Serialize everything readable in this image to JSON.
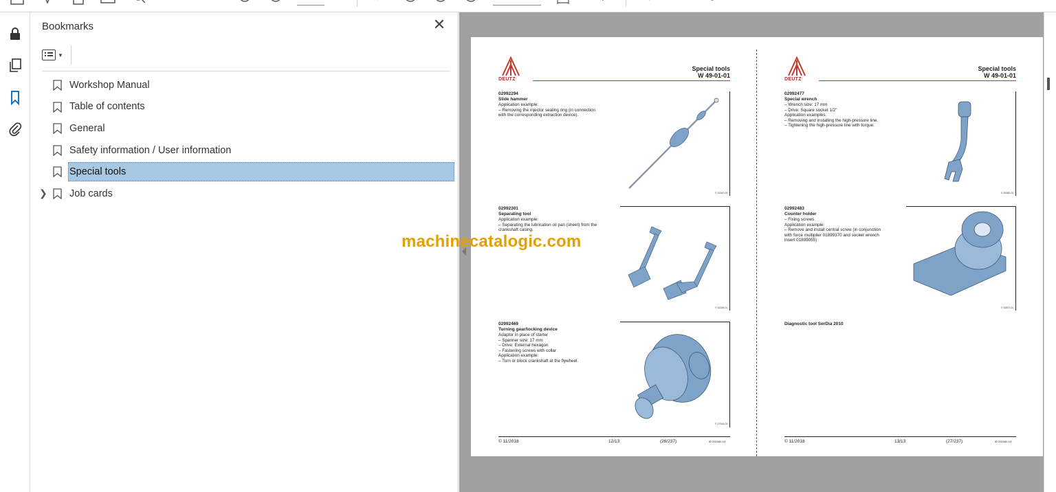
{
  "toolbar": {
    "icons": [
      "home-icon",
      "bookmark-add-icon",
      "upload-icon",
      "print-icon",
      "search-icon",
      "prev-page-icon",
      "next-page-icon",
      "select-tool-icon",
      "zoom-out-icon",
      "zoom-in-icon",
      "fit-width-icon",
      "scroll-icon",
      "comment-icon",
      "highlight-icon",
      "sign-icon",
      "draw-icon",
      "share-icon"
    ]
  },
  "rail": {
    "icons": [
      "lock-icon",
      "pages-icon",
      "bookmarks-icon",
      "attachments-icon"
    ]
  },
  "bookmarks_panel": {
    "title": "Bookmarks",
    "close_label": "✕",
    "items": [
      {
        "label": "Workshop Manual",
        "selected": false,
        "expandable": false
      },
      {
        "label": "Table of contents",
        "selected": false,
        "expandable": false
      },
      {
        "label": "General",
        "selected": false,
        "expandable": false
      },
      {
        "label": "Safety information / User information",
        "selected": false,
        "expandable": false
      },
      {
        "label": "Special tools",
        "selected": true,
        "expandable": false
      },
      {
        "label": "Job cards",
        "selected": false,
        "expandable": true
      }
    ]
  },
  "document": {
    "brand": "DEUTZ",
    "pages": [
      {
        "header_title": "Special tools",
        "header_code": "W 49-01-01",
        "sections": [
          {
            "part_no": "02992294",
            "name": "Slide hammer",
            "lines": [
              "Application example:",
              "– Removing the injector sealing ring (in connection",
              "   with the corresponding extraction device)."
            ],
            "fig": "© 32247-03"
          },
          {
            "part_no": "02992301",
            "name": "Separating tool",
            "lines": [
              "Application example:",
              "– Separating the lubrication oil pan (sheet) from the",
              "   crankshaft casing."
            ],
            "fig": "© 32249-01"
          },
          {
            "part_no": "02992469",
            "name": "Turning gear/locking device",
            "lines": [
              "Adaptor in place of starter",
              "– Spanner size: 17 mm",
              "– Drive: External hexagon",
              "– Fastening screws with collar",
              "Application example:",
              "– Turn or block crankshaft at the flywheel."
            ],
            "fig": "© 27919-01"
          }
        ],
        "footer": {
          "date": "© 11/2018",
          "page": "12/13",
          "total": "(26/237)",
          "id": "ID 002440-14"
        }
      },
      {
        "header_title": "Special tools",
        "header_code": "W 49-01-01",
        "sections": [
          {
            "part_no": "02992477",
            "name": "Special wrench",
            "lines": [
              "– Wrench size: 17 mm",
              "– Drive: Square socket 1/2\"",
              "Application examples:",
              "– Removing and installing the high-pressure line.",
              "– Tightening the high-pressure line with torque."
            ],
            "fig": "© 35180-01"
          },
          {
            "part_no": "02992483",
            "name": "Counter holder",
            "lines": [
              "– Fixing screws",
              "Application example:",
              "– Remove and install central screw (in conjunction",
              "   with force multiplier 01899370 and socket wrench",
              "   insert 01899055)"
            ],
            "fig": "© 32877-01"
          },
          {
            "part_no": "",
            "name": "Diagnostic tool SerDia 2010",
            "lines": [],
            "fig": ""
          }
        ],
        "footer": {
          "date": "© 11/2018",
          "page": "13/13",
          "total": "(27/237)",
          "id": "ID 002440-14"
        }
      }
    ]
  },
  "watermark": "machinecatalogic.com",
  "colors": {
    "selection": "#a6c8e2",
    "accent_red": "#c0392b",
    "viewer_bg": "#a0a0a0",
    "tool_blue": "#7fa3c8",
    "watermark": "#e3a000"
  }
}
